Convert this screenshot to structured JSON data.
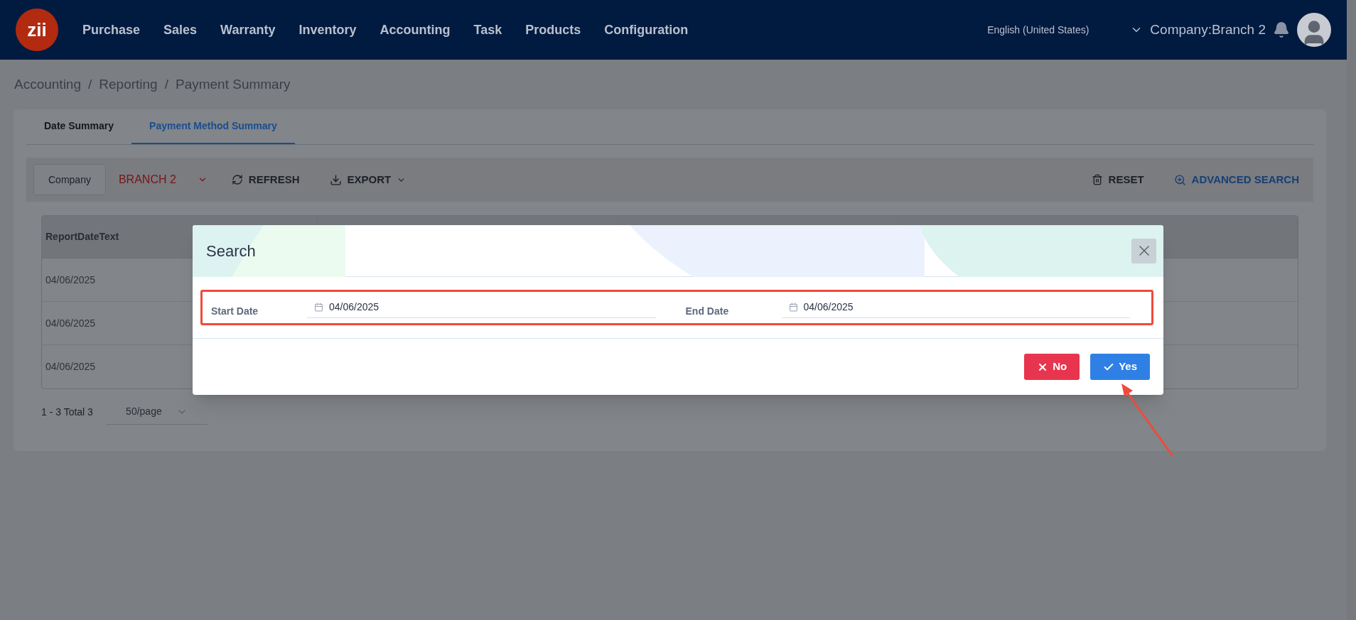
{
  "header": {
    "logo": "zii",
    "nav": [
      {
        "label": "Purchase"
      },
      {
        "label": "Sales"
      },
      {
        "label": "Warranty"
      },
      {
        "label": "Inventory"
      },
      {
        "label": "Accounting"
      },
      {
        "label": "Task"
      },
      {
        "label": "Products"
      },
      {
        "label": "Configuration"
      }
    ],
    "language": "English (United States)",
    "company": "Company:Branch 2"
  },
  "breadcrumb": [
    {
      "label": "Accounting"
    },
    {
      "separator": "/",
      "label": "Reporting"
    },
    {
      "separator": "/",
      "label": "Payment Summary"
    }
  ],
  "tabs": [
    {
      "label": "Date Summary",
      "selected": false
    },
    {
      "label": "Payment Method Summary",
      "selected": true
    }
  ],
  "toolbar": {
    "company_label": "Company",
    "branch": "BRANCH 2",
    "refresh": "REFRESH",
    "export": "EXPORT",
    "reset": "RESET",
    "advanced_search": "ADVANCED SEARCH"
  },
  "table": {
    "columns": [
      "ReportDateText"
    ],
    "rows": [
      [
        "04/06/2025"
      ],
      [
        "04/06/2025"
      ],
      [
        "04/06/2025"
      ]
    ]
  },
  "pagination": {
    "summary": "1 - 3 Total 3",
    "page_size": "50/page"
  },
  "dialog": {
    "title": "Search",
    "fields": [
      {
        "label": "Start Date",
        "value": "04/06/2025"
      },
      {
        "label": "End Date",
        "value": "04/06/2025"
      }
    ],
    "buttons": [
      {
        "kind": "cancel",
        "label": "No"
      },
      {
        "kind": "confirm",
        "label": "Yes"
      }
    ]
  }
}
